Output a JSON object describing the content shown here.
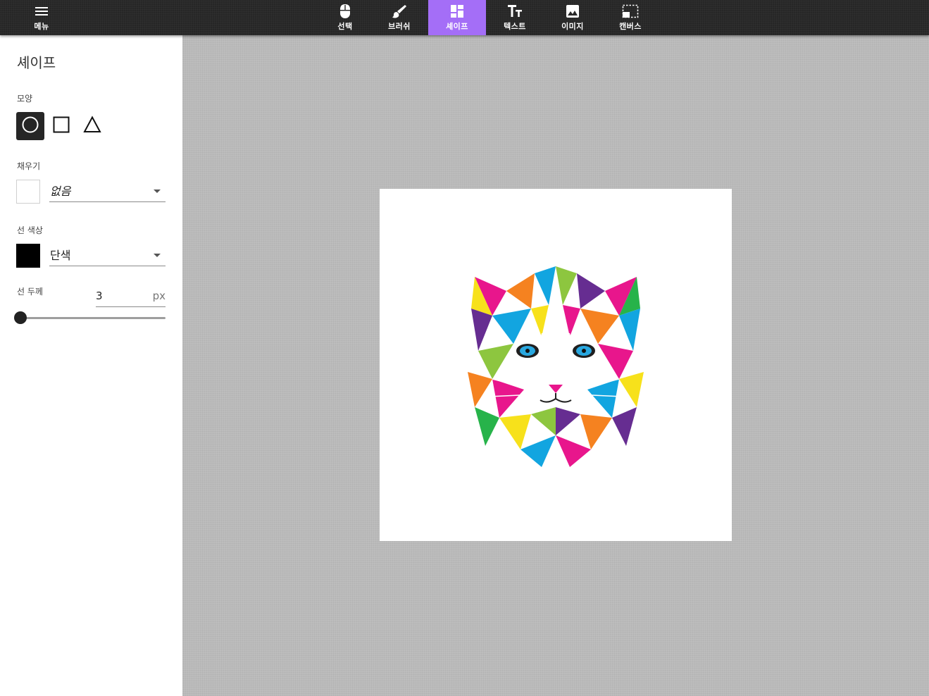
{
  "toolbar": {
    "menu": {
      "label": "메뉴",
      "icon": "menu-icon"
    },
    "tools": [
      {
        "label": "선택",
        "icon": "mouse-icon"
      },
      {
        "label": "브러쉬",
        "icon": "brush-icon"
      },
      {
        "label": "셰이프",
        "icon": "shapes-icon"
      },
      {
        "label": "텍스트",
        "icon": "text-icon"
      },
      {
        "label": "이미지",
        "icon": "image-icon"
      },
      {
        "label": "캔버스",
        "icon": "canvas-resize-icon"
      }
    ],
    "active_tool": "셰이프",
    "active_color": "#a46ef7"
  },
  "panel": {
    "title": "셰이프",
    "shape": {
      "label": "모양",
      "options": [
        "circle-icon",
        "square-icon",
        "triangle-icon"
      ],
      "selected": "circle-icon"
    },
    "fill": {
      "label": "채우기",
      "swatch_color": "#ffffff",
      "value": "없음"
    },
    "stroke_color": {
      "label": "선 색상",
      "swatch_color": "#000000",
      "value": "단색"
    },
    "stroke_width": {
      "label": "선 두께",
      "value": "3",
      "unit": "px",
      "slider_fraction": 0.03
    }
  },
  "canvas": {
    "background": "#ffffff",
    "image": "colorful-cat-illustration"
  }
}
